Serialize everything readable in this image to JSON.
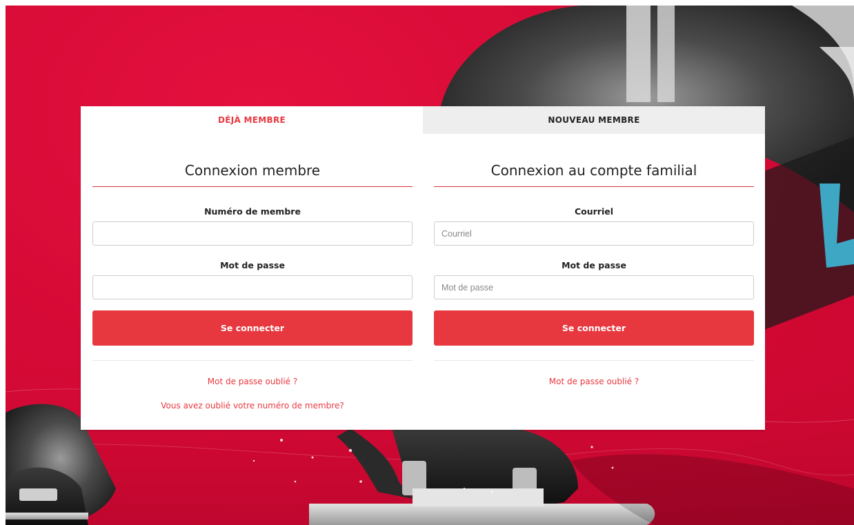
{
  "colors": {
    "accent": "#e8383f",
    "background": "#d60a36",
    "decor_arrow": "#3ea7c4"
  },
  "tabs": [
    {
      "label": "DÉJÀ MEMBRE",
      "active": true
    },
    {
      "label": "NOUVEAU MEMBRE",
      "active": false
    }
  ],
  "member_login": {
    "title": "Connexion membre",
    "member_number_label": "Numéro de membre",
    "member_number_value": "",
    "password_label": "Mot de passe",
    "password_value": "",
    "submit_label": "Se connecter",
    "forgot_password_link": "Mot de passe oublié ?",
    "forgot_member_number_link": "Vous avez oublié votre numéro de membre?"
  },
  "family_login": {
    "title": "Connexion au compte familial",
    "email_label": "Courriel",
    "email_placeholder": "Courriel",
    "password_label": "Mot de passe",
    "password_placeholder": "Mot de passe",
    "submit_label": "Se connecter",
    "forgot_password_link": "Mot de passe oublié ?"
  }
}
